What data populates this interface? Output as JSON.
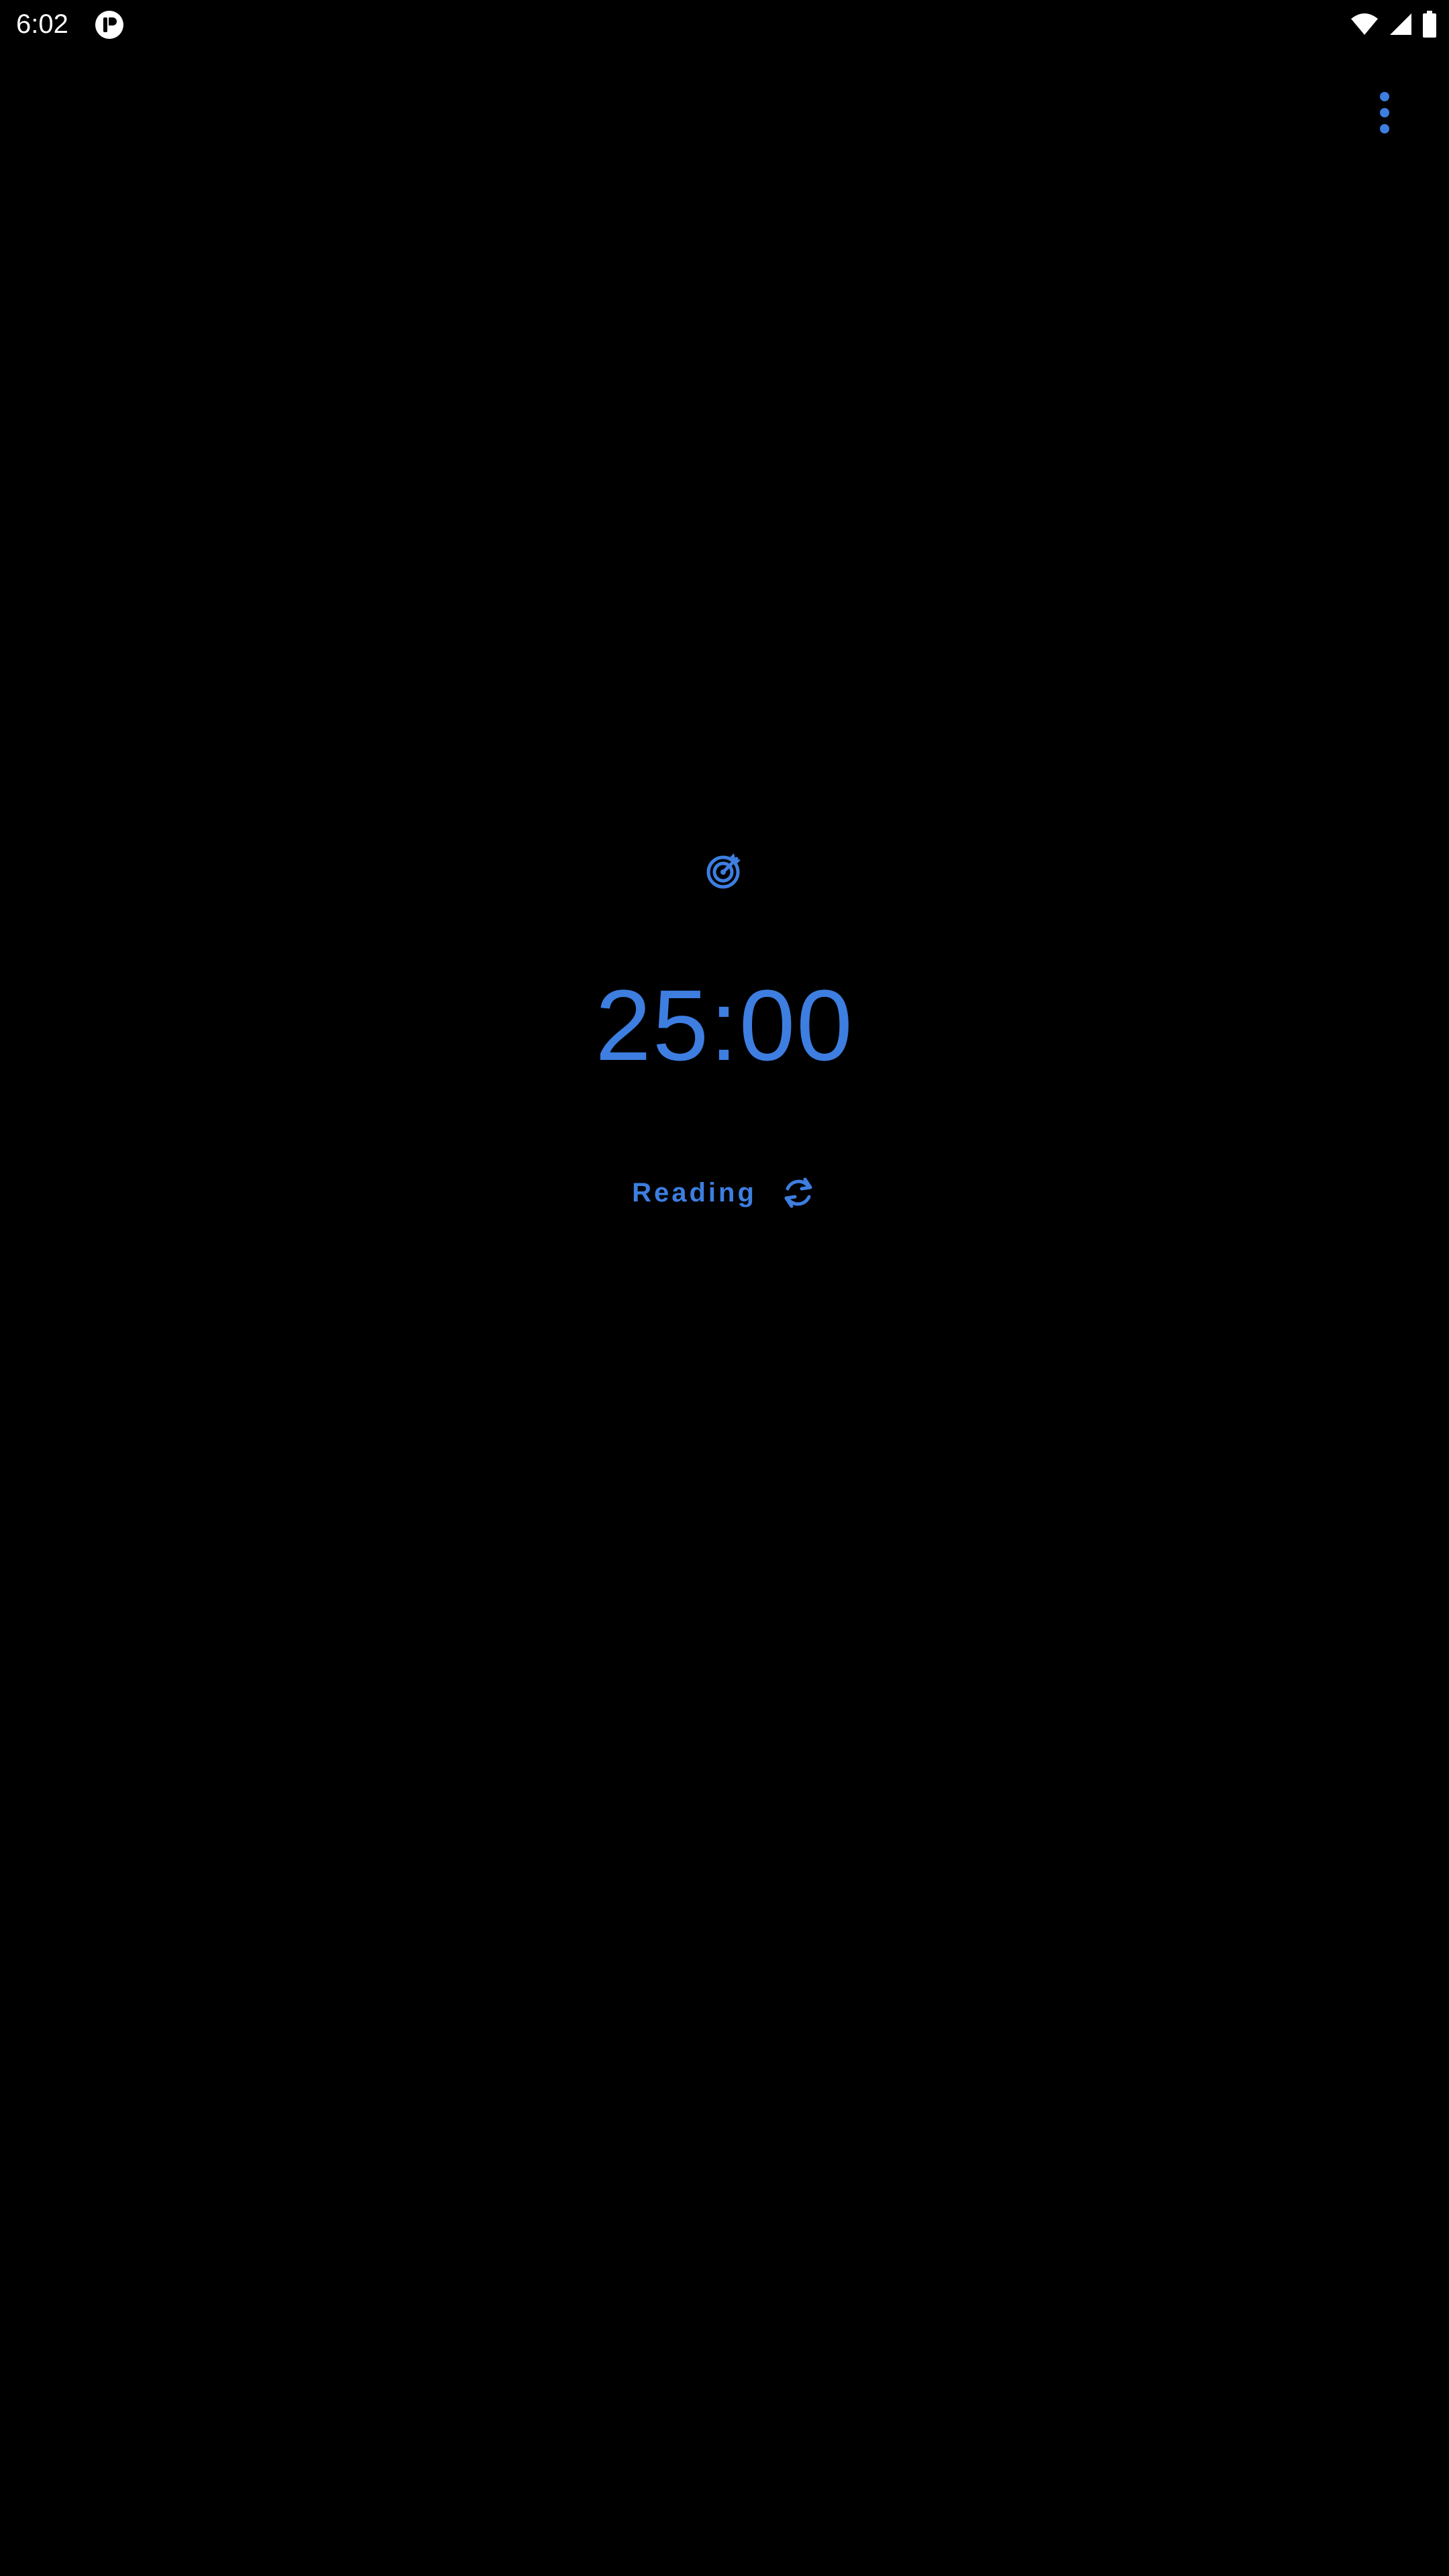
{
  "status_bar": {
    "time": "6:02",
    "notification_icon": "app-notification-icon",
    "wifi_icon": "wifi-icon",
    "signal_icon": "cellular-signal-icon",
    "battery_icon": "battery-icon"
  },
  "toolbar": {
    "overflow_icon": "more-vert-icon"
  },
  "timer": {
    "icon": "target-icon",
    "time": "25:00",
    "label": "Reading",
    "label_action_icon": "refresh-icon"
  },
  "colors": {
    "background": "#000000",
    "accent": "#3d7ee0",
    "status_text": "#ffffff"
  }
}
